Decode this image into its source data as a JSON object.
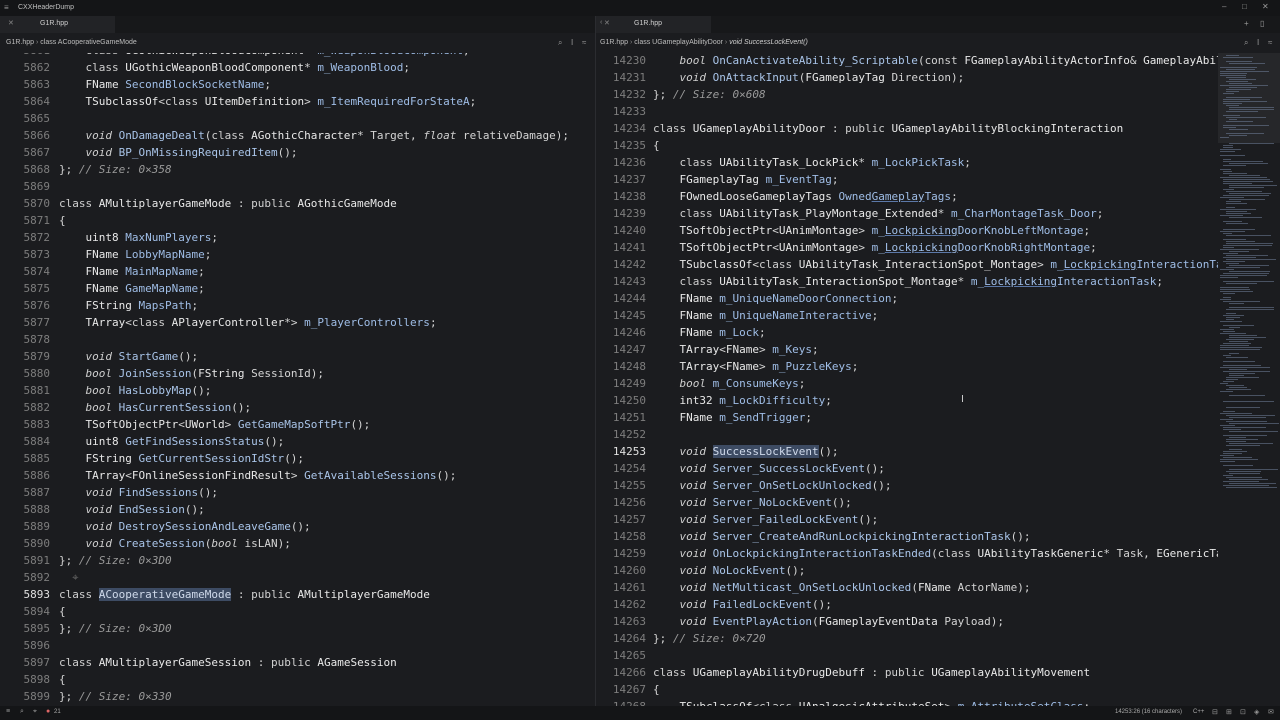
{
  "window": {
    "title": "CXXHeaderDump",
    "menu_icon": "hamburger-icon"
  },
  "left_pane": {
    "tab_label": "G1R.hpp",
    "breadcrumb": {
      "file": "G1R.hpp",
      "sep": " › ",
      "symbol": "class ACooperativeGameMode"
    }
  },
  "right_pane": {
    "tab_label": "G1R.hpp",
    "breadcrumb": {
      "file": "G1R.hpp",
      "sep1": " › ",
      "class": "class UGameplayAbilityDoor",
      "sep2": " › ",
      "symbol": "void SuccessLockEvent()"
    }
  },
  "status": {
    "problems_count": "21",
    "cursor_position": "14253:26 (16 characters)",
    "language": "C++"
  }
}
